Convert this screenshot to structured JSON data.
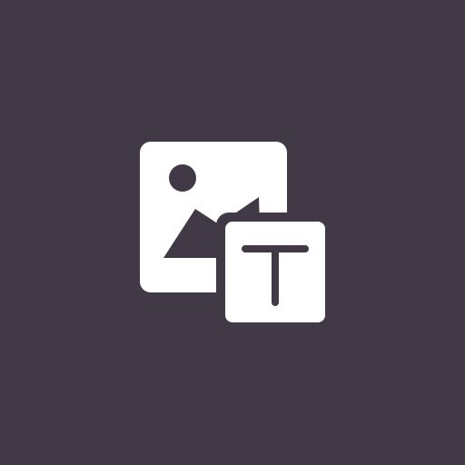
{
  "icon": {
    "name": "image-with-text-icon",
    "description_hidden": "",
    "colors": {
      "background": "#413a46",
      "foreground": "#ffffff",
      "cutout": "#413a46"
    }
  }
}
